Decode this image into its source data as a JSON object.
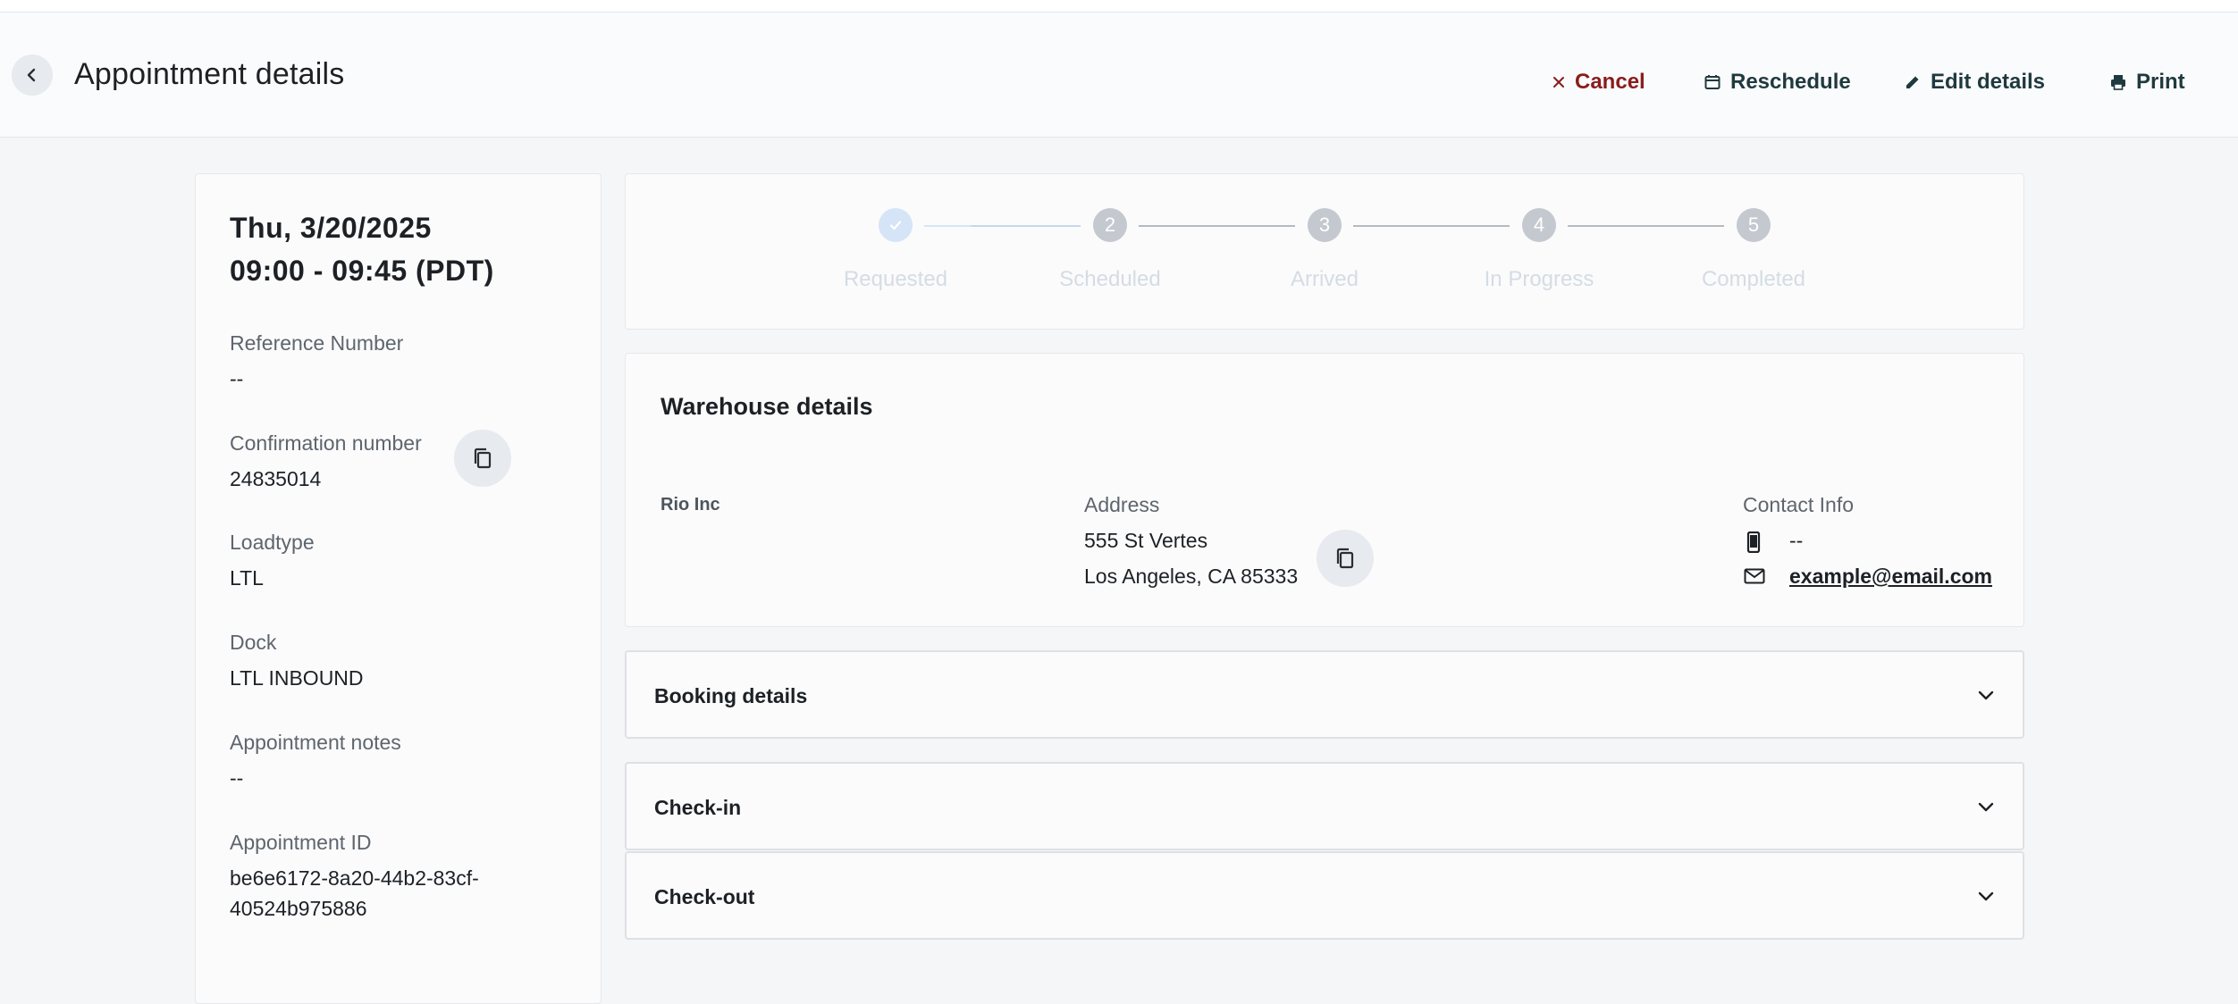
{
  "header": {
    "title": "Appointment details",
    "actions": {
      "cancel": "Cancel",
      "reschedule": "Reschedule",
      "edit": "Edit details",
      "print": "Print"
    }
  },
  "summary": {
    "date": "Thu, 3/20/2025",
    "time": "09:00 - 09:45 (PDT)",
    "fields": [
      {
        "label": "Reference Number",
        "value": "--"
      },
      {
        "label": "Confirmation number",
        "value": "24835014"
      },
      {
        "label": "Loadtype",
        "value": "LTL"
      },
      {
        "label": "Dock",
        "value": "LTL INBOUND"
      },
      {
        "label": "Appointment notes",
        "value": "--"
      },
      {
        "label": "Appointment ID",
        "value_line1": "be6e6172-8a20-44b2-83cf-",
        "value_line2": "40524b975886"
      }
    ]
  },
  "progress": {
    "steps": [
      {
        "number": "",
        "label": "Requested",
        "status": "done"
      },
      {
        "number": "2",
        "label": "Scheduled",
        "status": "pending"
      },
      {
        "number": "3",
        "label": "Arrived",
        "status": "pending"
      },
      {
        "number": "4",
        "label": "In Progress",
        "status": "pending"
      },
      {
        "number": "5",
        "label": "Completed",
        "status": "pending"
      }
    ]
  },
  "warehouse": {
    "title": "Warehouse details",
    "name": "Rio Inc",
    "address_label": "Address",
    "address_line1": "555 St Vertes",
    "address_line2": "Los Angeles, CA 85333",
    "contact_label": "Contact Info",
    "phone": "--",
    "email": "example@email.com"
  },
  "sections": [
    {
      "title": "Booking details"
    },
    {
      "title": "Check-in"
    },
    {
      "title": "Check-out"
    }
  ],
  "colors": {
    "cancel": "#8a1c1c",
    "action": "#1f3a3f",
    "step_done": "#d6e4f7",
    "step_pending": "#c4c9cf"
  },
  "icons": [
    "chevron-left-icon",
    "close-icon",
    "calendar-icon",
    "pencil-icon",
    "printer-icon",
    "copy-icon",
    "check-icon",
    "phone-icon",
    "mail-icon",
    "chevron-down-icon"
  ]
}
